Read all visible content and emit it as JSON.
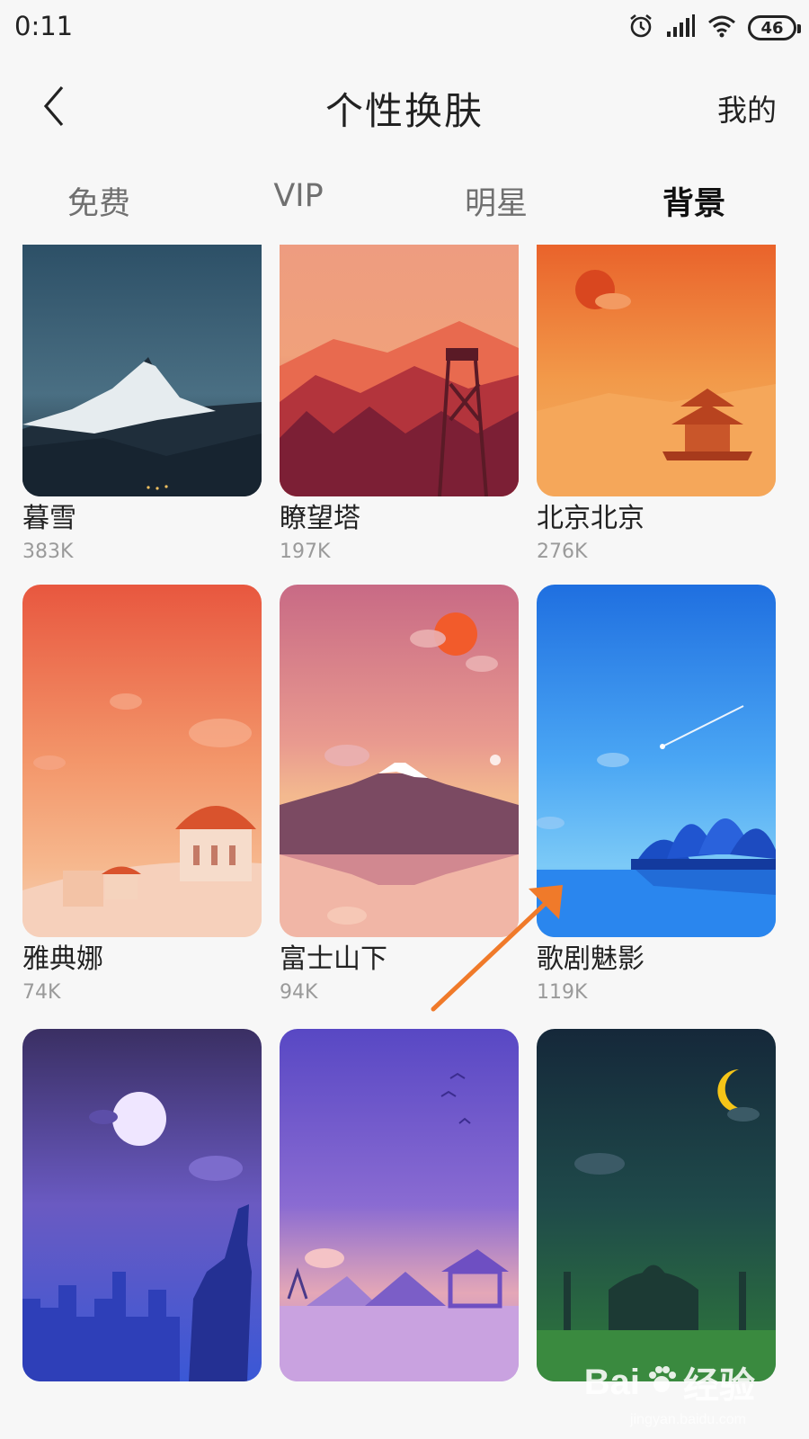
{
  "status_bar": {
    "time": "0:11",
    "battery": "46",
    "icons": [
      "alarm-icon",
      "signal-icon",
      "wifi-icon",
      "battery-icon"
    ]
  },
  "header": {
    "back_icon": "chevron-left-icon",
    "title": "个性换肤",
    "mine": "我的"
  },
  "tabs": [
    {
      "label": "免费",
      "active": false
    },
    {
      "label": "VIP",
      "active": false
    },
    {
      "label": "明星",
      "active": false
    },
    {
      "label": "背景",
      "active": true
    }
  ],
  "colors": {
    "tab_underline": "#ffe35a",
    "annotation_arrow": "#f07a2a"
  },
  "skins": [
    {
      "name": "暮雪",
      "count": "383K"
    },
    {
      "name": "瞭望塔",
      "count": "197K"
    },
    {
      "name": "北京北京",
      "count": "276K"
    },
    {
      "name": "雅典娜",
      "count": "74K"
    },
    {
      "name": "富士山下",
      "count": "94K"
    },
    {
      "name": "歌剧魅影",
      "count": "119K"
    },
    {
      "name": "",
      "count": ""
    },
    {
      "name": "",
      "count": ""
    },
    {
      "name": "",
      "count": ""
    }
  ],
  "watermark": {
    "brand": "Bai",
    "brand_cn": "经验",
    "url": "jingyan.baidu.com"
  }
}
